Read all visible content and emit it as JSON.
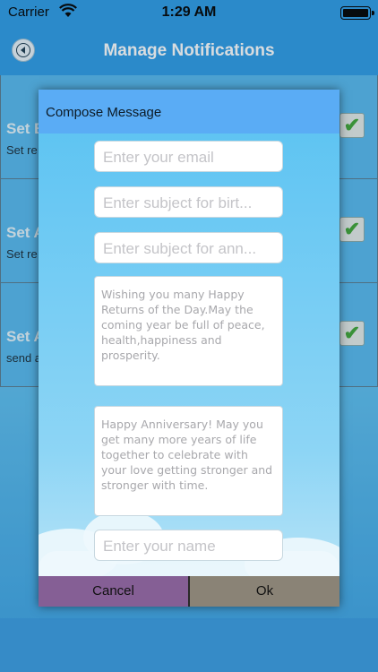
{
  "status_bar": {
    "carrier": "Carrier",
    "time": "1:29 AM"
  },
  "header": {
    "title": "Manage Notifications"
  },
  "list": [
    {
      "title": "Set B",
      "subtitle": "Set re",
      "checked": true
    },
    {
      "title": "Set A",
      "subtitle": "Set re",
      "checked": true
    },
    {
      "title": "Set A",
      "subtitle": "send a",
      "checked": true
    }
  ],
  "dialog": {
    "title": "Compose Message",
    "email_placeholder": "Enter your email",
    "birthday_subject_placeholder": "Enter subject for birt...",
    "anniversary_subject_placeholder": "Enter subject for ann...",
    "birthday_message": "Wishing you many Happy Returns of the Day.May the coming year be full of peace, health,happiness and prosperity.",
    "anniversary_message": "Happy Anniversary! May you get many more years of life together to celebrate with your love getting stronger and stronger with time.",
    "name_placeholder": "Enter your name",
    "cancel_label": "Cancel",
    "ok_label": "Ok"
  }
}
